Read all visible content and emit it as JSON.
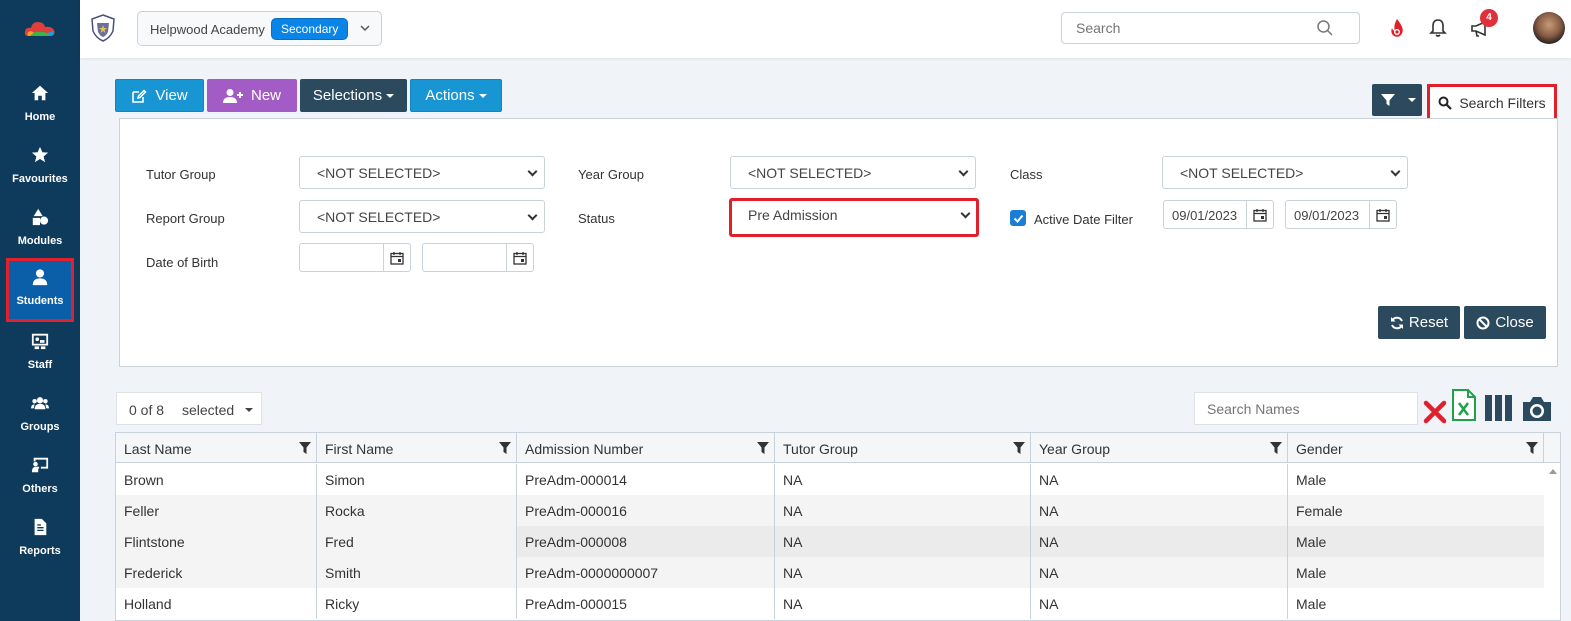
{
  "sidebar": {
    "items": [
      {
        "label": "Home",
        "icon": "home-icon"
      },
      {
        "label": "Favourites",
        "icon": "star-icon"
      },
      {
        "label": "Modules",
        "icon": "shapes-icon"
      },
      {
        "label": "Students",
        "icon": "user-icon",
        "active": true
      },
      {
        "label": "Staff",
        "icon": "chalkboard-icon"
      },
      {
        "label": "Groups",
        "icon": "users-icon"
      },
      {
        "label": "Others",
        "icon": "teacher-icon"
      },
      {
        "label": "Reports",
        "icon": "file-icon"
      }
    ]
  },
  "topbar": {
    "school_name": "Helpwood Academy",
    "school_type": "Secondary",
    "search_placeholder": "Search",
    "notification_count": "4"
  },
  "toolbar": {
    "view_label": "View",
    "new_label": "New",
    "selections_label": "Selections",
    "actions_label": "Actions",
    "search_filters_label": "Search Filters"
  },
  "filters": {
    "tutor_group_label": "Tutor Group",
    "tutor_group_value": "<NOT SELECTED>",
    "year_group_label": "Year Group",
    "year_group_value": "<NOT SELECTED>",
    "class_label": "Class",
    "class_value": "<NOT SELECTED>",
    "report_group_label": "Report Group",
    "report_group_value": "<NOT SELECTED>",
    "status_label": "Status",
    "status_value": "Pre Admission",
    "active_date_label": "Active Date Filter",
    "active_date_from": "09/01/2023",
    "active_date_to": "09/01/2023",
    "dob_label": "Date of Birth",
    "dob_from": "",
    "dob_to": "",
    "reset_label": "Reset",
    "close_label": "Close"
  },
  "grid": {
    "selected_count": "0 of 8",
    "selected_label": "selected",
    "name_search_placeholder": "Search Names",
    "columns": [
      "Last Name",
      "First Name",
      "Admission Number",
      "Tutor Group",
      "Year Group",
      "Gender"
    ],
    "rows": [
      [
        "Brown",
        "Simon",
        "PreAdm-000014",
        "NA",
        "NA",
        "Male"
      ],
      [
        "Feller",
        "Rocka",
        "PreAdm-000016",
        "NA",
        "NA",
        "Female"
      ],
      [
        "Flintstone",
        "Fred",
        "PreAdm-000008",
        "NA",
        "NA",
        "Male"
      ],
      [
        "Frederick",
        "Smith",
        "PreAdm-0000000007",
        "NA",
        "NA",
        "Male"
      ],
      [
        "Holland",
        "Ricky",
        "PreAdm-000015",
        "NA",
        "NA",
        "Male"
      ]
    ]
  },
  "colors": {
    "sidebar": "#0e3a5c",
    "primary": "#1896d4",
    "purple": "#a35cc6",
    "dark": "#2b4a5e",
    "highlight": "#e0202b"
  }
}
